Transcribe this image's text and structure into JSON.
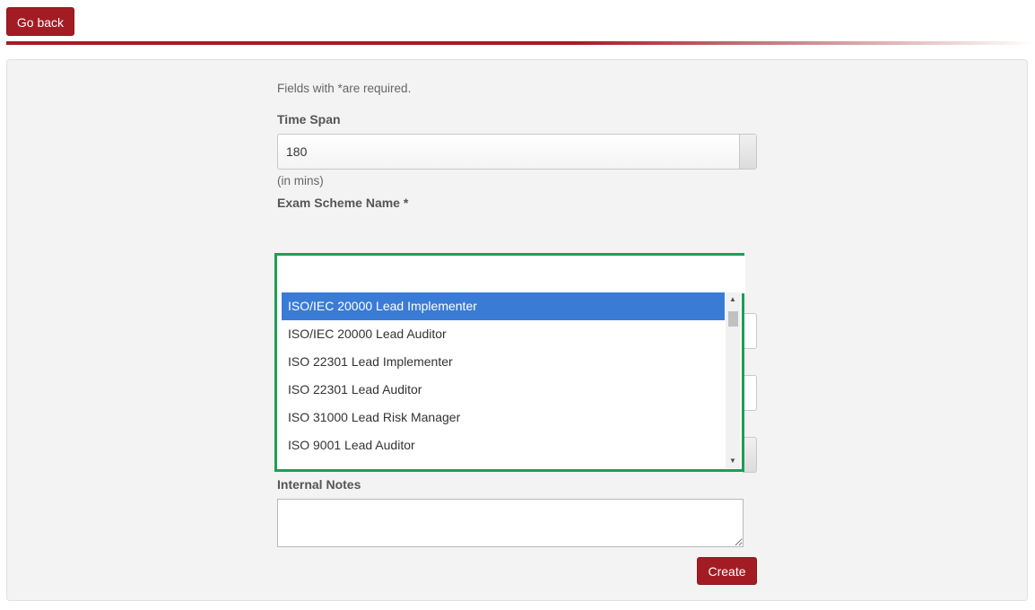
{
  "header": {
    "go_back_label": "Go back",
    "accent_color": "#a31c24"
  },
  "form": {
    "required_note": "Fields with *are required.",
    "time_span": {
      "label": "Time Span",
      "value": "180",
      "hint": "(in mins)"
    },
    "exam_scheme": {
      "label": "Exam Scheme Name *",
      "search_value": "",
      "options": [
        {
          "label": "ISO/IEC 20000 Lead Implementer",
          "selected": true
        },
        {
          "label": "ISO/IEC 20000 Lead Auditor",
          "selected": false
        },
        {
          "label": "ISO 22301 Lead Implementer",
          "selected": false
        },
        {
          "label": "ISO 22301 Lead Auditor",
          "selected": false
        },
        {
          "label": "ISO 31000 Lead Risk Manager",
          "selected": false
        },
        {
          "label": "ISO 9001 Lead Auditor",
          "selected": false
        }
      ],
      "highlight_color": "#3a7bd5",
      "focus_border_color": "#1f9d55"
    },
    "internal_notes": {
      "label": "Internal Notes",
      "value": ""
    },
    "create_label": "Create"
  }
}
